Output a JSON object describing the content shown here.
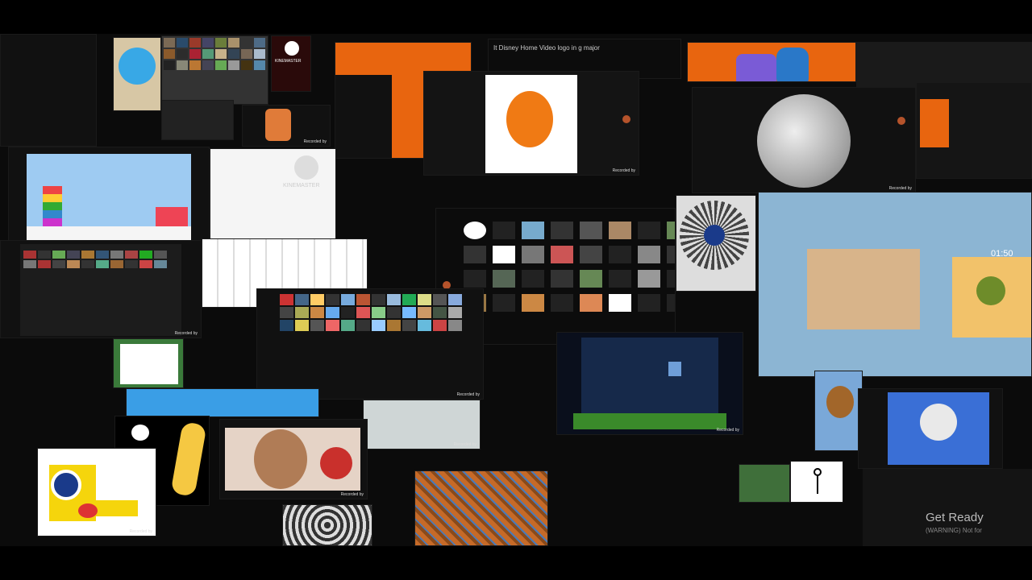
{
  "watermark": {
    "recorded_by": "Recorded by",
    "kinemaster": "KINEMASTER"
  },
  "video_title": "It Disney Home Video logo in g major",
  "timer": "01:50",
  "overlay": {
    "get_ready": "Get Ready",
    "warning": "(WARNING) Not for"
  },
  "colors": {
    "orange": "#e8650f",
    "cyan": "#5ab8d6",
    "yellow": "#f5d50c",
    "rust": "#b5532b"
  },
  "icons": [
    "kinemaster-logo",
    "moon",
    "elmo-toy",
    "spiral",
    "stick-figure"
  ]
}
